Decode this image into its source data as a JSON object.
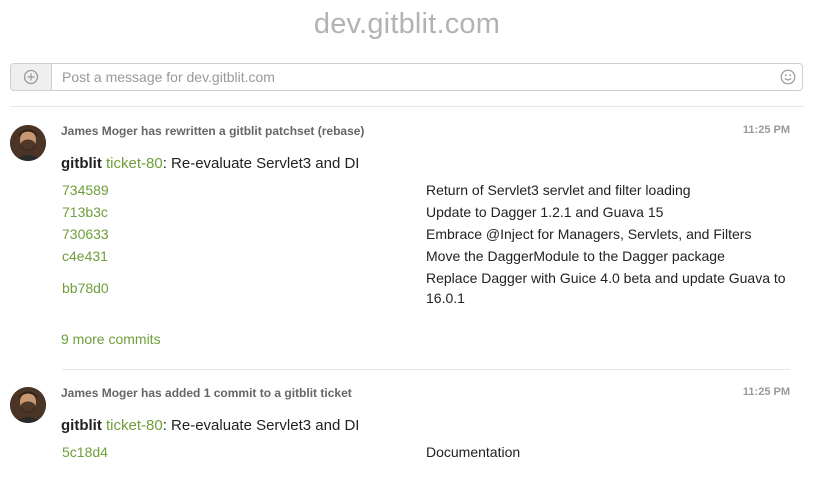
{
  "header": {
    "title": "dev.gitblit.com"
  },
  "composer": {
    "placeholder": "Post a message for dev.gitblit.com",
    "add_icon": "plus-circle-icon",
    "emoji_icon": "smiley-icon"
  },
  "posts": [
    {
      "author_line": "James Moger has rewritten a gitblit patchset (rebase)",
      "time": "11:25 PM",
      "repo": "gitblit",
      "ticket": "ticket-80",
      "ticket_title": ": Re-evaluate Servlet3 and DI",
      "commits": [
        {
          "sha": "734589",
          "message": "Return of Servlet3 servlet and filter loading"
        },
        {
          "sha": "713b3c",
          "message": "Update to Dagger 1.2.1 and Guava 15"
        },
        {
          "sha": "730633",
          "message": "Embrace @Inject for Managers, Servlets, and Filters"
        },
        {
          "sha": "c4e431",
          "message": "Move the DaggerModule to the Dagger package"
        },
        {
          "sha": "bb78d0",
          "message": "Replace Dagger with Guice 4.0 beta and update Guava to 16.0.1"
        }
      ],
      "more_link": "9 more commits"
    },
    {
      "author_line": "James Moger has added 1 commit to a gitblit ticket",
      "time": "11:25 PM",
      "repo": "gitblit",
      "ticket": "ticket-80",
      "ticket_title": ": Re-evaluate Servlet3 and DI",
      "commits": [
        {
          "sha": "5c18d4",
          "message": "Documentation"
        }
      ]
    }
  ],
  "colors": {
    "link": "#6e9f3b",
    "muted": "#999999"
  }
}
